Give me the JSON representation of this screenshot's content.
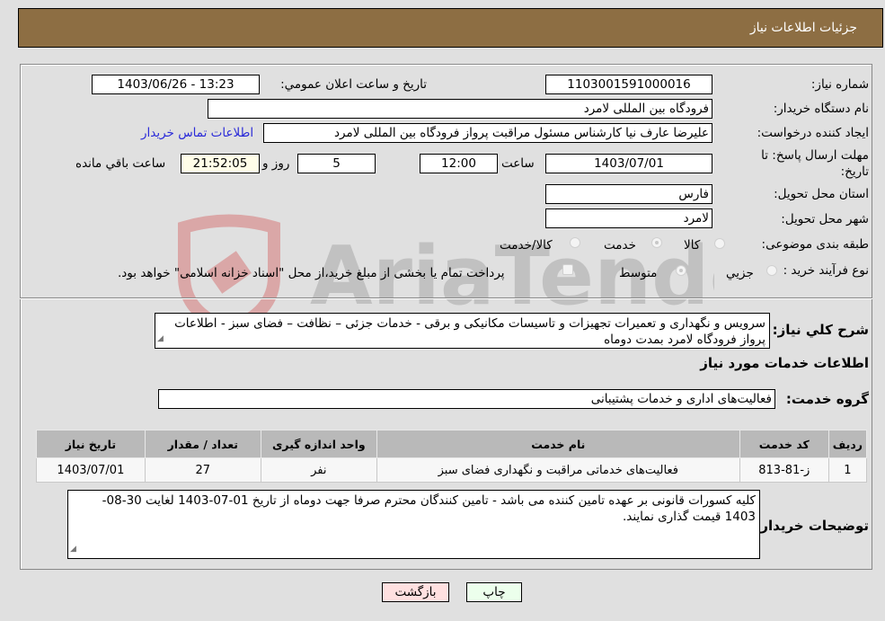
{
  "header": {
    "title": "جزئیات اطلاعات نیاز"
  },
  "form": {
    "need_number": {
      "label": "شماره نیاز:",
      "value": "1103001591000016"
    },
    "announce_datetime": {
      "label": "تاریخ و ساعت اعلان عمومي:",
      "value": "1403/06/26 - 13:23"
    },
    "buyer_org": {
      "label": "نام دستگاه خريدار:",
      "value": "فرودگاه بین المللی لامرد"
    },
    "requester": {
      "label": "ايجاد كننده درخواست:",
      "value": "علیرضا عارف نیا کارشناس مسئول مراقبت پرواز فرودگاه بین المللی لامرد",
      "contact_link": "اطلاعات تماس خريدار"
    },
    "deadline": {
      "label_line1": "مهلت ارسال پاسخ: تا",
      "label_line2": "تاريخ:",
      "date": "1403/07/01",
      "time_label": "ساعت",
      "time": "12:00",
      "days": "5",
      "days_label": "روز و",
      "remaining": "21:52:05",
      "remaining_label": "ساعت باقي مانده"
    },
    "province": {
      "label": "استان محل تحويل:",
      "value": "فارس"
    },
    "city": {
      "label": "شهر محل تحويل:",
      "value": "لامرد"
    },
    "category": {
      "label": "طبقه بندی موضوعی:",
      "options": [
        "کالا",
        "خدمت",
        "کالا/خدمت"
      ],
      "selected": "خدمت"
    },
    "purchase_type": {
      "label": "نوع فرآيند خريد :",
      "options": [
        "جزيي",
        "متوسط"
      ],
      "selected": "متوسط",
      "treasury_note": "پرداخت تمام یا بخشی از مبلغ خرید،از محل \"اسناد خزانه اسلامی\" خواهد بود."
    },
    "description": {
      "label": "شرح كلي نياز:",
      "value": "سرویس و نگهداری و تعمیرات تجهیزات و تاسیسات مکانیکی و برقی - خدمات جزئی – نظافت – فضای سبز - اطلاعات پرواز  فرودگاه لامرد بمدت دوماه"
    },
    "services_heading": "اطلاعات خدمات مورد نياز",
    "service_group": {
      "label": "گروه خدمت:",
      "value": "فعالیت‌های اداری و خدمات پشتیبانی"
    }
  },
  "table": {
    "headers": [
      "رديف",
      "كد خدمت",
      "نام خدمت",
      "واحد اندازه گيری",
      "تعداد / مقدار",
      "تاريخ نياز"
    ],
    "rows": [
      [
        "1",
        "ز-81-813",
        "فعالیت‌های خدماتی مراقبت و نگهداری فضای سبز",
        "نفر",
        "27",
        "1403/07/01"
      ]
    ]
  },
  "buyer_notes": {
    "label": "توضيحات خريدار:",
    "value": "کلیه کسورات قانونی بر عهده تامین کننده می باشد - تامین کنندگان محترم صرفا جهت دوماه از تاریخ 01-07-1403 لغایت 30-08-1403 قیمت گذاری نمایند."
  },
  "buttons": {
    "print": "چاپ",
    "back": "بازگشت"
  },
  "colors": {
    "header_bg": "#8d6e43",
    "print_bg": "#ecffec",
    "back_bg": "#ffe0e0",
    "link": "#2a2ad8",
    "remaining_bg": "#fffde8"
  }
}
